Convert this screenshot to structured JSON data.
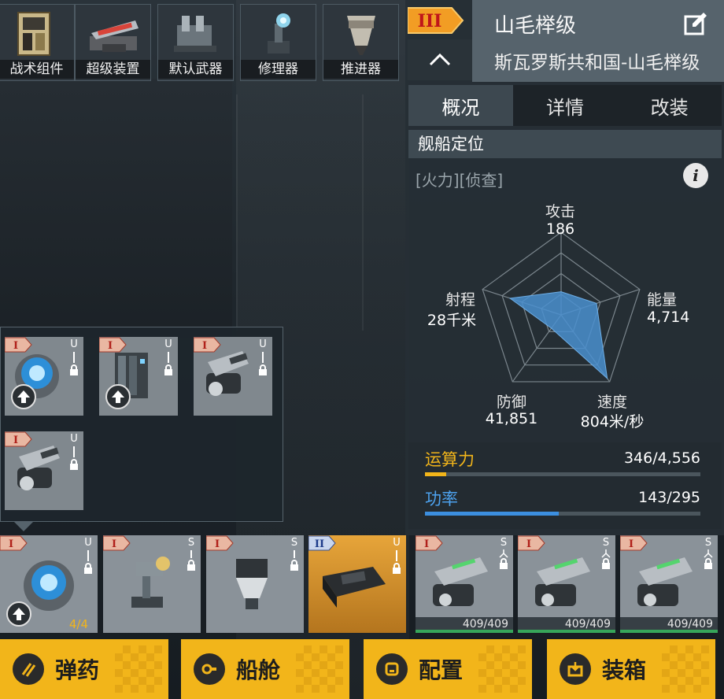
{
  "categories": [
    {
      "label": "战术组件",
      "icon": "tactical-module-icon"
    },
    {
      "label": "超级装置",
      "icon": "super-device-icon"
    },
    {
      "label": "默认武器",
      "icon": "default-weapon-icon"
    },
    {
      "label": "修理器",
      "icon": "repair-icon"
    },
    {
      "label": "推进器",
      "icon": "thruster-icon"
    }
  ],
  "ship": {
    "tier": "III",
    "name": "山毛榉级",
    "subtitle": "斯瓦罗斯共和国-山毛榉级",
    "collapse": "^"
  },
  "tabs": [
    {
      "label": "概况",
      "active": true
    },
    {
      "label": "详情",
      "active": false
    },
    {
      "label": "改装",
      "active": false
    }
  ],
  "positioning": {
    "heading": "舰船定位",
    "tags": "[火力][侦查]",
    "info": "i"
  },
  "stats": {
    "attack": {
      "name": "攻击",
      "value": "186",
      "level": 0.28
    },
    "energy": {
      "name": "能量",
      "value": "4,714",
      "level": 0.45
    },
    "speed": {
      "name": "速度",
      "value": "804米/秒",
      "level": 0.95
    },
    "defense": {
      "name": "防御",
      "value": "41,851",
      "level": 0.2
    },
    "range": {
      "name": "射程",
      "value": "28千米",
      "level": 0.65
    }
  },
  "resources": {
    "compute": {
      "label": "运算力",
      "value": "346/4,556",
      "fraction": 0.076,
      "color": "#f2b51a"
    },
    "power": {
      "label": "功率",
      "value": "143/295",
      "fraction": 0.485,
      "color": "#3c8fe0"
    }
  },
  "popup_slots": [
    {
      "tier": "I",
      "letter": "U",
      "art": "core-module",
      "upgrade": true
    },
    {
      "tier": "I",
      "letter": "U",
      "art": "battery-module",
      "upgrade": true
    },
    {
      "tier": "I",
      "letter": "U",
      "art": "turret-module",
      "upgrade": false
    },
    {
      "tier": "I",
      "letter": "U",
      "art": "turret-module",
      "upgrade": false
    }
  ],
  "bottom_slots": [
    {
      "tier": "I",
      "letter": "U",
      "count": "4/4",
      "art": "core-module"
    },
    {
      "tier": "I",
      "letter": "S",
      "art": "missile-launcher"
    },
    {
      "tier": "I",
      "letter": "S",
      "art": "container-module"
    },
    {
      "tier": "II",
      "letter": "U",
      "art": "armor-module"
    },
    {
      "tier": "I",
      "letter": "S",
      "hp": "409/409",
      "art": "cannon"
    },
    {
      "tier": "I",
      "letter": "S",
      "hp": "409/409",
      "art": "cannon"
    },
    {
      "tier": "I",
      "letter": "S",
      "hp": "409/409",
      "art": "cannon"
    }
  ],
  "actions": [
    {
      "label": "弹药",
      "icon": "ammo-icon"
    },
    {
      "label": "船舱",
      "icon": "cabin-icon"
    },
    {
      "label": "配置",
      "icon": "config-icon"
    },
    {
      "label": "装箱",
      "icon": "crate-icon"
    }
  ],
  "colors": {
    "accent": "#f2b51a",
    "tier1": "#e9b7a2",
    "tier2": "#c9d6ee",
    "tier3": "#f29d24",
    "radar_fill": "#4a8fcf",
    "hp_green": "#37a65a"
  }
}
